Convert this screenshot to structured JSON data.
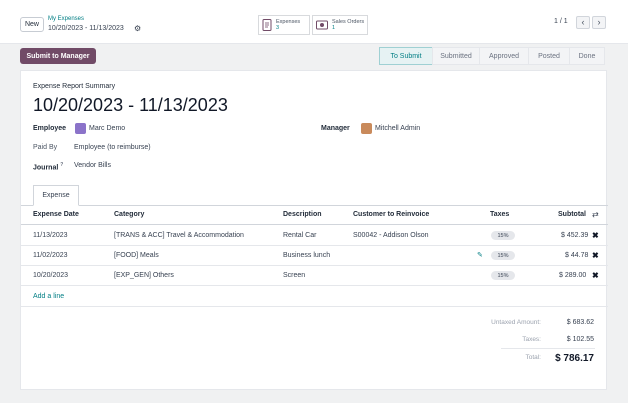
{
  "header": {
    "new_label": "New",
    "breadcrumb_parent": "My Expenses",
    "breadcrumb_current": "10/20/2023 - 11/13/2023",
    "pager_text": "1 / 1"
  },
  "smart_buttons": [
    {
      "label": "Expenses",
      "count": "3",
      "icon": "receipt-icon"
    },
    {
      "label": "Sales Orders",
      "count": "1",
      "icon": "dollar-icon"
    }
  ],
  "actions": {
    "submit_label": "Submit to Manager"
  },
  "statusbar": [
    "To Submit",
    "Submitted",
    "Approved",
    "Posted",
    "Done"
  ],
  "form": {
    "subtitle": "Expense Report Summary",
    "title": "10/20/2023 - 11/13/2023",
    "employee_label": "Employee",
    "employee_value": "Marc Demo",
    "manager_label": "Manager",
    "manager_value": "Mitchell Admin",
    "paid_by_label": "Paid By",
    "paid_by_value": "Employee (to reimburse)",
    "journal_label": "Journal",
    "journal_sup": "?",
    "journal_value": "Vendor Bills"
  },
  "tab": {
    "label": "Expense"
  },
  "table": {
    "columns": [
      "Expense Date",
      "Category",
      "Description",
      "Customer to Reinvoice",
      "Taxes",
      "Subtotal"
    ],
    "rows": [
      {
        "date": "11/13/2023",
        "category": "[TRANS & ACC] Travel & Accommodation",
        "description": "Rental Car",
        "customer": "S00042 - Addison Olson",
        "tax": "15%",
        "subtotal": "$ 452.39"
      },
      {
        "date": "11/02/2023",
        "category": "[FOOD] Meals",
        "description": "Business lunch",
        "customer": "",
        "tax": "15%",
        "subtotal": "$ 44.78"
      },
      {
        "date": "10/20/2023",
        "category": "[EXP_GEN] Others",
        "description": "Screen",
        "customer": "",
        "tax": "15%",
        "subtotal": "$ 289.00"
      }
    ],
    "add_line": "Add a line"
  },
  "totals": {
    "untaxed_label": "Untaxed Amount:",
    "untaxed_value": "$ 683.62",
    "taxes_label": "Taxes:",
    "taxes_value": "$ 102.55",
    "total_label": "Total:",
    "total_value": "$ 786.17"
  },
  "colors": {
    "brand": "#714b67",
    "accent": "#017e84"
  }
}
